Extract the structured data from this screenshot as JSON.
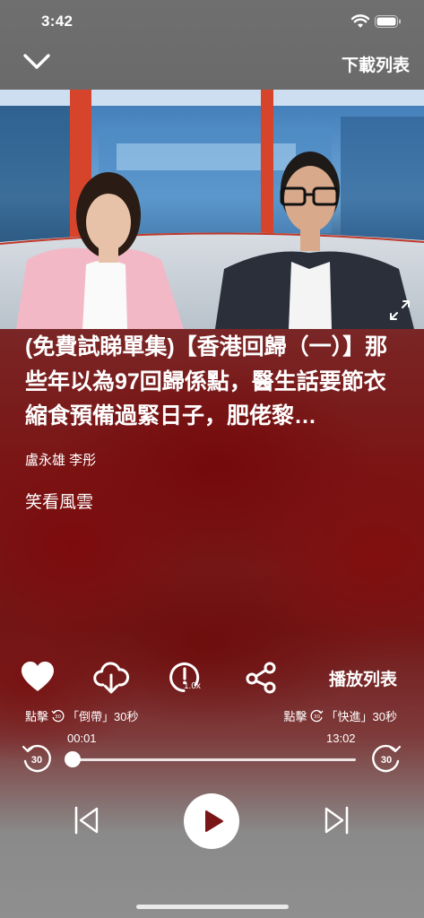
{
  "status_bar": {
    "time": "3:42"
  },
  "nav": {
    "download_label": "下載列表"
  },
  "episode": {
    "title": "(免費試睇單集)【香港回歸（一）】那些年以為97回歸係點，醫生話要節衣縮食預備過緊日子，肥佬黎…",
    "hosts": "盧永雄 李彤",
    "program": "笑看風雲"
  },
  "actions": {
    "speed_badge": "1.0x",
    "playlist_label": "播放列表"
  },
  "hints": {
    "prefix_left": "點擊",
    "rewind_text": "「倒帶」30秒",
    "prefix_right": "點擊",
    "forward_text": "「快進」30秒",
    "skip_seconds": "30"
  },
  "progress": {
    "elapsed": "00:01",
    "total": "13:02",
    "fraction": 0.0013
  }
}
